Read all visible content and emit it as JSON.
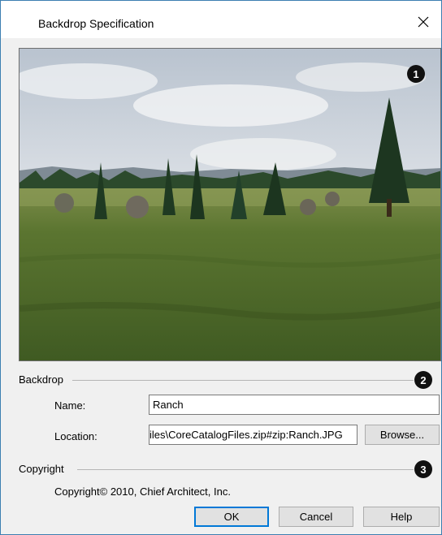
{
  "window": {
    "title": "Backdrop Specification",
    "close_label": "✕"
  },
  "callouts": [
    "1",
    "2",
    "3"
  ],
  "backdrop": {
    "group_label": "Backdrop",
    "name_label": "Name:",
    "name_value": "Ranch",
    "location_label": "Location:",
    "location_value": "iles\\CoreCatalogFiles.zip#zip:Ranch.JPG",
    "browse_label": "Browse..."
  },
  "copyright": {
    "group_label": "Copyright",
    "text": "Copyright© 2010, Chief Architect, Inc."
  },
  "buttons": {
    "ok": "OK",
    "cancel": "Cancel",
    "help": "Help"
  },
  "colors": {
    "sky": "#d9dde3",
    "grass": "#4f6a2a",
    "trees": "#1f3a22",
    "accent": "#0078d7"
  }
}
